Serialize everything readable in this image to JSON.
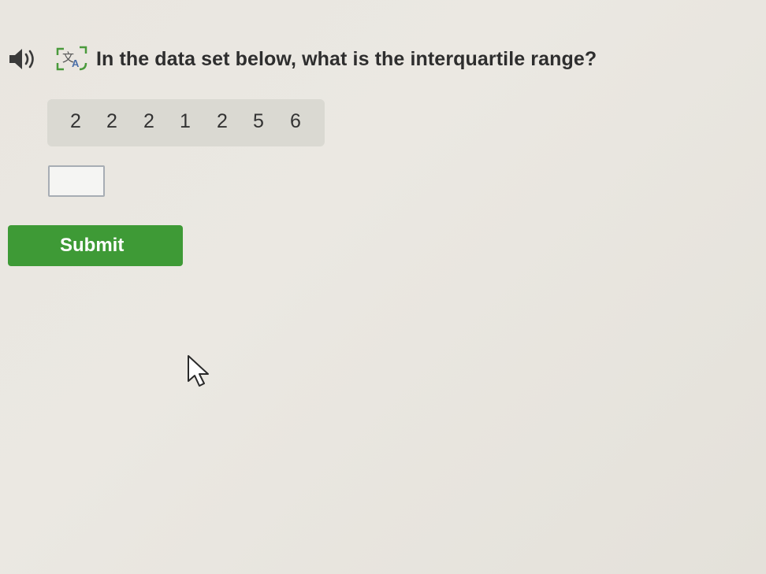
{
  "question": {
    "text": "In the data set below, what is the interquartile range?",
    "audio_icon": "speaker-icon",
    "translate_icon": "translate-icon"
  },
  "data_set": {
    "values": [
      "2",
      "2",
      "2",
      "1",
      "2",
      "5",
      "6"
    ]
  },
  "answer": {
    "value": "",
    "placeholder": ""
  },
  "submit": {
    "label": "Submit"
  },
  "colors": {
    "submit_bg": "#3e9a36",
    "data_box_bg": "#dad9d2",
    "icon_green": "#4a9a3c"
  }
}
